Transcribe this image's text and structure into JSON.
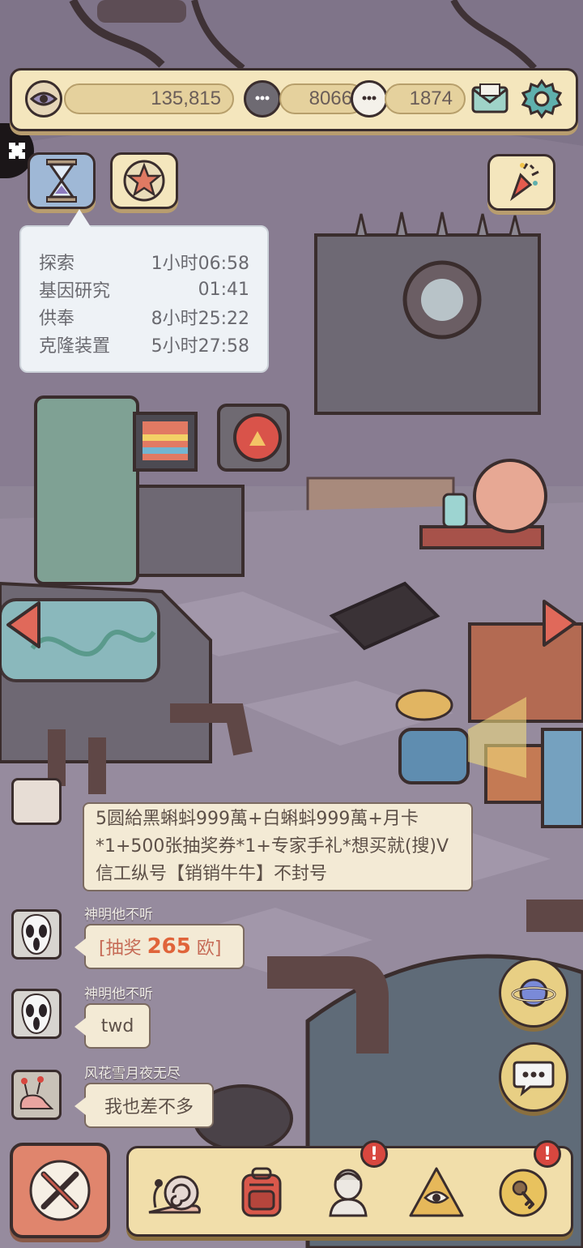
{
  "resources": {
    "eye_value": "135,815",
    "gray_bubble_value": "8066",
    "white_bubble_value": "1874"
  },
  "timers": [
    {
      "name": "探索",
      "time": "1小时06:58"
    },
    {
      "name": "基因研究",
      "time": "01:41"
    },
    {
      "name": "供奉",
      "time": "8小时25:22"
    },
    {
      "name": "克隆装置",
      "time": "5小时27:58"
    }
  ],
  "chat": {
    "announcement": "5圆給黑蝌蚪999萬+白蝌蚪999萬+月卡*1+500张抽奖券*1+专家手礼*想买就(搜)V信工纵号【销销牛牛】不封号",
    "messages": [
      {
        "name": "神明他不听",
        "prefix": "[抽奖 ",
        "amount": "265",
        "suffix": " 欧]"
      },
      {
        "name": "神明他不听",
        "text": "twd"
      },
      {
        "name": "风花雪月夜无尽",
        "text": "我也差不多"
      }
    ]
  },
  "icons": {
    "top": [
      "eye-icon",
      "gray-speech-icon",
      "white-speech-icon",
      "mail-icon",
      "gear-icon"
    ],
    "buttons": [
      "hourglass-icon",
      "star-icon",
      "confetti-icon",
      "planet-icon",
      "chat-icon"
    ],
    "nav": [
      "snail-icon",
      "backpack-icon",
      "bust-icon",
      "pyramid-eye-icon",
      "key-icon"
    ],
    "badge_symbol": "!"
  },
  "colors": {
    "panel": "#f4e6bd",
    "outline": "#3a2d2d",
    "accent_red": "#d8473f",
    "gold": "#e8cf84",
    "lottery_amount": "#e0643a"
  }
}
